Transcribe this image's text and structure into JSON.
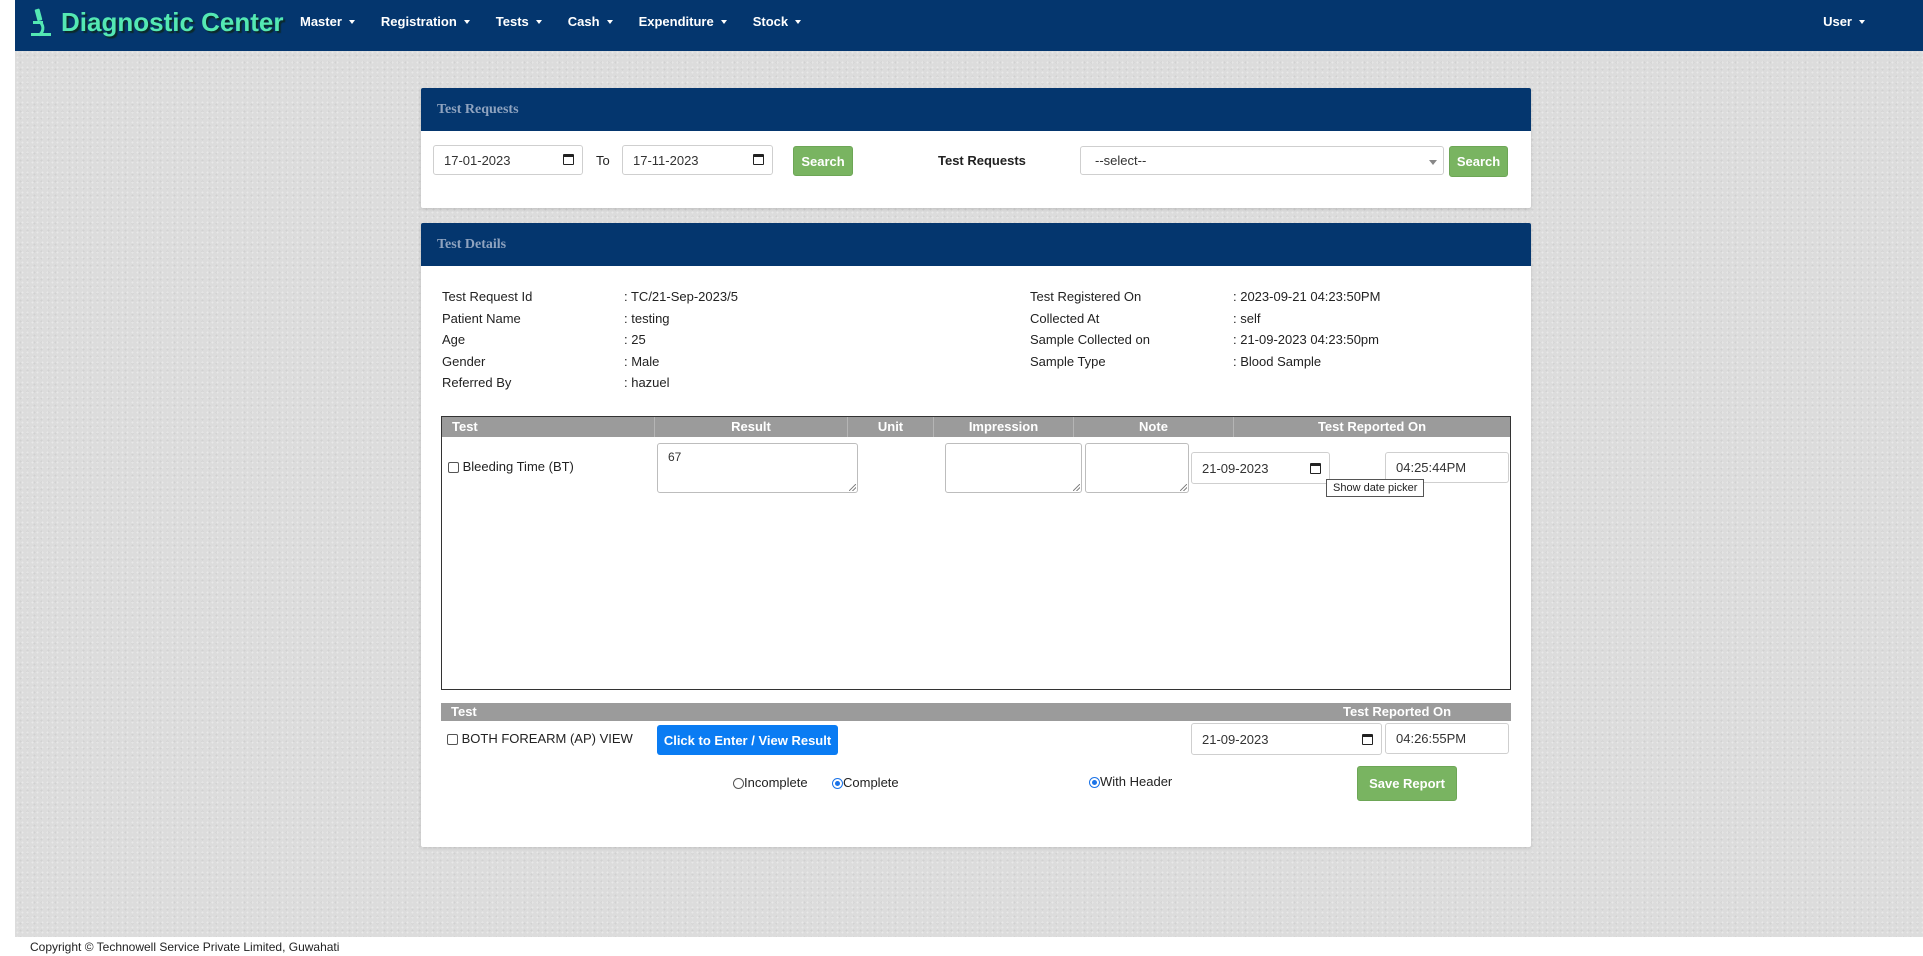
{
  "navbar": {
    "brand": "Diagnostic Center",
    "menu": [
      {
        "label": "Master"
      },
      {
        "label": "Registration"
      },
      {
        "label": "Tests"
      },
      {
        "label": "Cash"
      },
      {
        "label": "Expenditure"
      },
      {
        "label": "Stock"
      }
    ],
    "user": "User"
  },
  "requests_panel": {
    "title": "Test Requests",
    "from_date": "17-01-2023",
    "to_label": "To",
    "to_date": "17-11-2023",
    "search_label": "Search",
    "test_requests_label": "Test Requests",
    "select_value": "--select--",
    "search2_label": "Search"
  },
  "details_panel": {
    "title": "Test Details",
    "left": [
      {
        "label": "Test Request Id",
        "value": ": TC/21-Sep-2023/5"
      },
      {
        "label": "Patient Name",
        "value": ": testing"
      },
      {
        "label": "Age",
        "value": ": 25"
      },
      {
        "label": "Gender",
        "value": ": Male"
      },
      {
        "label": "Referred By",
        "value": ": hazuel"
      }
    ],
    "right": [
      {
        "label": "Test Registered On",
        "value": ": 2023-09-21 04:23:50PM"
      },
      {
        "label": "Collected At",
        "value": ": self"
      },
      {
        "label": "Sample Collected on",
        "value": ": 21-09-2023 04:23:50pm"
      },
      {
        "label": "Sample Type",
        "value": ": Blood Sample"
      }
    ]
  },
  "results_table": {
    "headers": [
      "Test",
      "Result",
      "Unit",
      "Impression",
      "Note",
      "Test Reported On"
    ],
    "rows": [
      {
        "test": "Bleeding Time (BT)",
        "result": "67",
        "unit": "",
        "impression": "",
        "note": "",
        "date": "21-09-2023",
        "time": "04:25:44PM"
      }
    ],
    "tooltip": "Show date picker"
  },
  "radiology_table": {
    "headers": [
      "Test",
      "Test Reported On"
    ],
    "rows": [
      {
        "test": "BOTH FOREARM (AP) VIEW",
        "button": "Click to Enter / View Result",
        "date": "21-09-2023",
        "time": "04:26:55PM"
      }
    ]
  },
  "report_options": {
    "incomplete_label": "Incomplete",
    "complete_label": "Complete",
    "with_header_label": "With Header",
    "selected_status": "Complete",
    "with_header": true,
    "save_label": "Save Report"
  },
  "footer": {
    "copyright": "Copyright © Technowell Service Private Limited, Guwahati"
  },
  "colors": {
    "navbar": "#04366e",
    "brand": "#54e8b3",
    "search_button": "#79b461",
    "enter_result_button": "#0a7cf3",
    "table_header": "#9b9b9b"
  }
}
